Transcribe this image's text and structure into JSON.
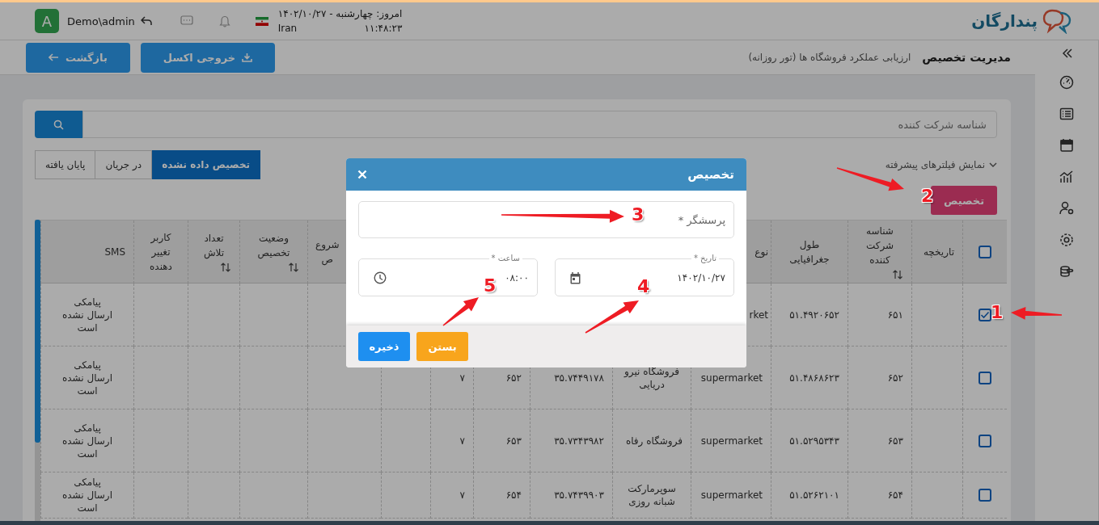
{
  "header": {
    "logo_text": "پندارگان",
    "user_initial": "A",
    "username": "Demo\\admin",
    "date_line": "امروز: چهارشنبه - ۱۴۰۲/۱۰/۲۷",
    "country": "Iran",
    "time": "۱۱:۴۸:۲۳"
  },
  "breadcrumb": {
    "title": "مدیریت تخصیص",
    "subtitle": "ارزیابی عملکرد فروشگاه ها (تور روزانه)"
  },
  "actions": [
    {
      "kind": "export",
      "label": "خروجی اکسل"
    },
    {
      "kind": "back",
      "label": "بازگشت"
    }
  ],
  "search": {
    "placeholder": "شناسه شرکت کننده"
  },
  "advanced_filters": {
    "label": "نمایش فیلترهای پیشرفته",
    "expanded": false
  },
  "status_tabs": [
    {
      "label": "تخصیص داده نشده",
      "selected": true
    },
    {
      "label": "در جریان",
      "selected": false
    },
    {
      "label": "پایان یافته",
      "selected": false
    }
  ],
  "assign_button": {
    "label": "تخصیص"
  },
  "table": {
    "select_all_checked": false,
    "columns": [
      {
        "kind": "checkbox"
      },
      {
        "kind": "text",
        "label": "تاریخچه",
        "sortable": false
      },
      {
        "kind": "text",
        "label": "شناسه شرکت کننده",
        "sortable": true
      },
      {
        "kind": "text",
        "label": "طول جغرافیایی",
        "sortable": false
      },
      {
        "kind": "text",
        "label": "نوع",
        "sortable": false
      },
      {
        "kind": "text"
      },
      {
        "kind": "text"
      },
      {
        "kind": "text"
      },
      {
        "kind": "text"
      },
      {
        "kind": "text"
      },
      {
        "kind": "text",
        "label": "شروع\nص"
      },
      {
        "kind": "text",
        "label": "وضعیت تخصیص",
        "sortable": true
      },
      {
        "kind": "text",
        "label": "تعداد تلاش",
        "sortable": true
      },
      {
        "kind": "text",
        "label": "کاربر تغییر دهنده",
        "sortable": false
      },
      {
        "kind": "text",
        "label": "SMS",
        "sortable": false
      }
    ],
    "rows": [
      {
        "selected": true,
        "cells": [
          "",
          "",
          "۶۵۱",
          "۵۱.۴۹۲۰۶۵۲",
          "rket",
          "",
          "",
          "",
          "",
          "",
          "",
          "",
          "",
          "",
          "پیامکی ارسال نشده است"
        ]
      },
      {
        "selected": false,
        "cells": [
          "",
          "",
          "۶۵۲",
          "۵۱.۴۸۶۸۶۲۳",
          "supermarket",
          "فروشگاه نیرو دریایی",
          "۳۵.۷۴۴۹۱۷۸",
          "۶۵۲",
          "۷",
          "",
          "",
          "",
          "",
          "",
          "پیامکی ارسال نشده است"
        ]
      },
      {
        "selected": false,
        "cells": [
          "",
          "",
          "۶۵۳",
          "۵۱.۵۲۹۵۳۴۳",
          "supermarket",
          "فروشگاه رفاه",
          "۳۵.۷۳۴۳۹۸۲",
          "۶۵۳",
          "۷",
          "",
          "",
          "",
          "",
          "",
          "پیامکی ارسال نشده است"
        ]
      },
      {
        "selected": false,
        "cells": [
          "",
          "",
          "۶۵۴",
          "۵۱.۵۲۶۲۱۰۱",
          "supermarket",
          "سوپرمارکت شبانه روزی",
          "۳۵.۷۴۳۹۹۰۳",
          "۶۵۴",
          "۷",
          "",
          "",
          "",
          "",
          "",
          "پیامکی ارسال نشده است"
        ]
      }
    ]
  },
  "dialog": {
    "title": "تخصیص",
    "fields": [
      {
        "kind": "text",
        "placeholder": "پرسشگر *"
      },
      {
        "kind": "date",
        "label": "تاریخ *",
        "value": "۱۴۰۲/۱۰/۲۷"
      },
      {
        "kind": "time",
        "label": "ساعت *",
        "value": "۰۸:۰۰"
      }
    ],
    "buttons": [
      {
        "kind": "close",
        "label": "بستن"
      },
      {
        "kind": "save",
        "label": "ذخیره"
      }
    ]
  },
  "annotations": [
    {
      "label": "1"
    },
    {
      "label": "2"
    },
    {
      "label": "3"
    },
    {
      "label": "4"
    },
    {
      "label": "5"
    }
  ]
}
